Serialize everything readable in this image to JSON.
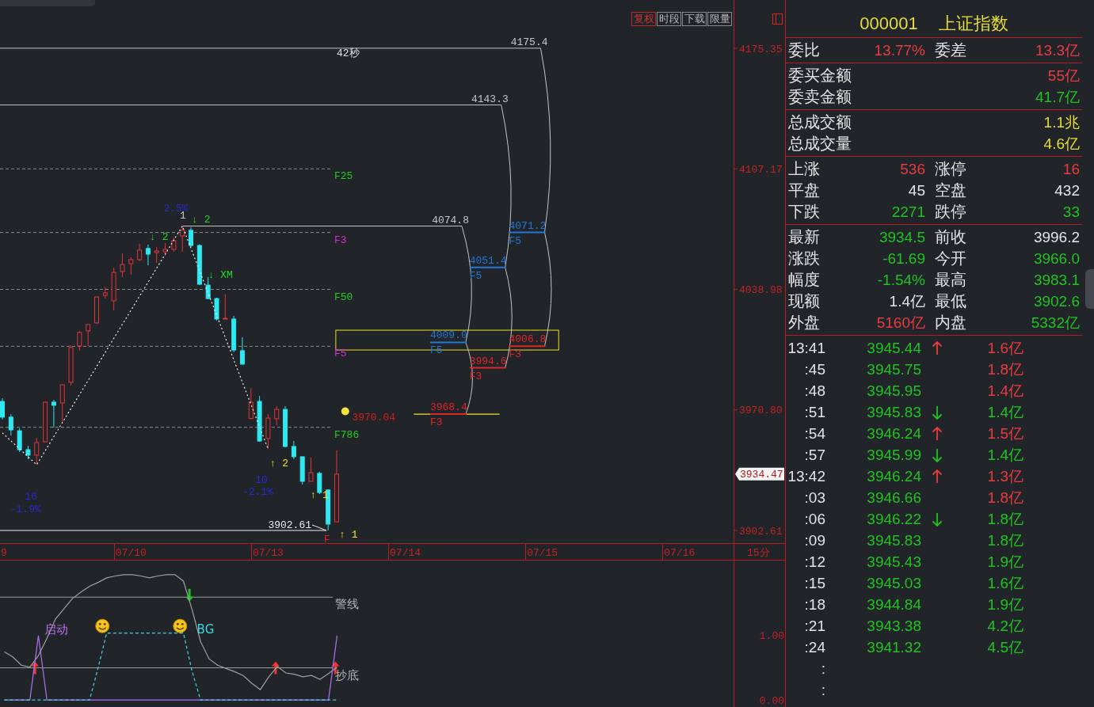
{
  "main_chart": {
    "toolbar": [
      {
        "label": "复权",
        "selected": true
      },
      {
        "label": "时段",
        "selected": false
      },
      {
        "label": "下载",
        "selected": false
      },
      {
        "label": "限量",
        "selected": false
      }
    ],
    "chart_data": [
      {
        "type": "candlestick",
        "categories": [
          "9",
          null,
          null,
          null,
          null,
          null,
          null,
          null,
          null,
          null,
          null,
          null,
          null,
          null,
          null,
          "07/10",
          null,
          null,
          null,
          null,
          null,
          null,
          null,
          null,
          null,
          null,
          null,
          null,
          null,
          null,
          null,
          "07/13",
          null,
          null,
          null,
          null,
          null,
          null,
          null,
          null,
          null,
          null,
          null,
          null,
          null,
          null,
          null,
          "07/14",
          null,
          null,
          null,
          null,
          null,
          null,
          null,
          null,
          null,
          null,
          null,
          null,
          null,
          null,
          null,
          "07/15",
          null,
          null,
          null,
          null,
          null,
          null,
          null,
          null,
          null,
          null,
          null,
          null,
          null,
          null,
          null,
          "07/16",
          null,
          null,
          null,
          null,
          null
        ],
        "ohlc": [
          [
            3975.6,
            3977.4,
            3965.3,
            3966.7
          ],
          [
            3966.7,
            3968.4,
            3956.4,
            3959.5
          ],
          [
            3959.0,
            3960.4,
            3947.0,
            3948.3
          ],
          [
            3948.3,
            3950.5,
            3942.9,
            3945.2
          ],
          [
            3945.2,
            3955.0,
            3939.8,
            3952.3
          ],
          [
            3952.8,
            3975.6,
            3952.3,
            3975.2
          ],
          [
            3975.2,
            3976.5,
            3960.8,
            3973.4
          ],
          [
            3974.7,
            3985.5,
            3964.0,
            3985.0
          ],
          [
            3986.4,
            4007.4,
            3984.6,
            4006.1
          ],
          [
            4007.0,
            4015.5,
            4004.3,
            4014.6
          ],
          [
            4015.5,
            4019.1,
            4007.0,
            4019.1
          ],
          [
            4020.0,
            4035.0,
            4019.6,
            4034.7
          ],
          [
            4035.6,
            4040.6,
            4033.8,
            4037.0
          ],
          [
            4032.5,
            4051.3,
            4027.1,
            4048.6
          ],
          [
            4049.1,
            4059.4,
            4045.9,
            4053.1
          ],
          [
            4053.5,
            4057.1,
            4047.3,
            4055.8
          ],
          [
            4055.8,
            4064.7,
            4054.9,
            4061.2
          ],
          [
            4062.1,
            4064.3,
            4052.6,
            4058.9
          ],
          [
            4059.8,
            4062.9,
            4054.0,
            4060.7
          ],
          [
            4060.3,
            4065.2,
            4058.0,
            4061.6
          ],
          [
            4061.6,
            4068.3,
            4060.3,
            4066.5
          ],
          [
            4069.2,
            4074.8,
            4060.3,
            4072.4
          ],
          [
            4072.4,
            4074.1,
            4062.9,
            4063.8
          ],
          [
            4063.8,
            4064.5,
            4041.4,
            4041.9
          ],
          [
            4041.4,
            4045.9,
            4033.4,
            4033.8
          ],
          [
            4033.8,
            4034.3,
            4021.3,
            4022.2
          ],
          [
            4022.2,
            4036.3,
            4022.2,
            4022.6
          ],
          [
            4022.2,
            4024.0,
            4003.4,
            4004.7
          ],
          [
            4004.3,
            4011.9,
            3996.2,
            3996.7
          ],
          [
            3966.0,
            3983.1,
            3965.3,
            3975.2
          ],
          [
            3975.6,
            3978.7,
            3952.8,
            3953.2
          ],
          [
            3954.6,
            3968.4,
            3948.7,
            3966.2
          ],
          [
            3965.8,
            3972.9,
            3962.2,
            3971.1
          ],
          [
            3971.1,
            3972.9,
            3949.6,
            3950.1
          ],
          [
            3950.1,
            3953.2,
            3942.9,
            3944.3
          ],
          [
            3944.3,
            3944.3,
            3928.6,
            3930.4
          ],
          [
            3930.4,
            3943.8,
            3930.4,
            3935.3
          ],
          [
            3934.9,
            3935.8,
            3923.2,
            3924.1
          ],
          [
            3925.5,
            3925.9,
            3902.61,
            3906.2
          ],
          [
            3907.5,
            3947.8,
            3907.1,
            3934.47
          ],
          null,
          null,
          null,
          null,
          null,
          null,
          null,
          null,
          null,
          null,
          null,
          null,
          null,
          null,
          null,
          null,
          null,
          null,
          null,
          null,
          null,
          null,
          null,
          null,
          null,
          null,
          null,
          null,
          null,
          null,
          null,
          null,
          null,
          null,
          null,
          null,
          null,
          null,
          null,
          null,
          null,
          null,
          null,
          null,
          null
        ],
        "ylim": [
          3895.45,
          4202.67
        ],
        "yticks": [
          4175.35,
          4107.17,
          4038.98,
          {
            "value": 3970.8,
            "label": "3970.80"
          },
          3902.61
        ],
        "series": [
          {
            "type": "line",
            "color": "#f0f0f0",
            "line_style": "dotted",
            "values": [
              3957.8,
              3953.3,
              3948.8,
              3944.3,
              3939.8,
              3947.7,
              3955.7,
              3963.6,
              3971.6,
              3979.5,
              3987.4,
              3995.4,
              4003.3,
              4011.3,
              4019.2,
              4027.1,
              4035.1,
              4043.0,
              4051.0,
              4058.9,
              4066.9,
              4074.8,
              4062.2,
              4049.6,
              4037.0,
              4024.4,
              4011.8,
              3999.1,
              3986.5,
              3973.9,
              3961.3,
              3948.7,
              null,
              null,
              null,
              null,
              null,
              null,
              null,
              null,
              null,
              null,
              null,
              null,
              null,
              null,
              null,
              null,
              null,
              null,
              null,
              null,
              null,
              null,
              null,
              null,
              null,
              null,
              null,
              null,
              null,
              null,
              null,
              null,
              null,
              null,
              null,
              null,
              null,
              null,
              null,
              null,
              null,
              null,
              null,
              null,
              null,
              null,
              null,
              null,
              null,
              null,
              null,
              null,
              null
            ]
          },
          {
            "type": "scatter",
            "color": "#f2e63a",
            "values": [
              null,
              null,
              null,
              null,
              null,
              null,
              null,
              null,
              null,
              null,
              null,
              null,
              null,
              null,
              null,
              null,
              null,
              null,
              null,
              null,
              null,
              null,
              null,
              null,
              null,
              null,
              null,
              null,
              null,
              null,
              null,
              null,
              null,
              null,
              null,
              null,
              null,
              null,
              null,
              null,
              3970,
              null,
              null,
              null,
              null,
              null,
              null,
              null,
              null,
              null,
              null,
              null,
              null,
              null,
              null,
              null,
              null,
              null,
              null,
              null,
              null,
              null,
              null,
              null,
              null,
              null,
              null,
              null,
              null,
              null,
              null,
              null,
              null,
              null,
              null,
              null,
              null,
              null,
              null,
              null,
              null,
              null,
              null,
              null,
              null
            ]
          },
          {
            "type": "line",
            "color": "#f0e030",
            "values": [
              null,
              null,
              null,
              null,
              null,
              null,
              null,
              null,
              null,
              null,
              null,
              null,
              null,
              null,
              null,
              null,
              null,
              null,
              null,
              null,
              null,
              null,
              null,
              null,
              null,
              null,
              null,
              null,
              null,
              null,
              null,
              null,
              null,
              null,
              null,
              null,
              null,
              null,
              null,
              null,
              null,
              null,
              null,
              null,
              null,
              null,
              null,
              null,
              3968.4,
              3968.4,
              3968.4,
              3968.4,
              3968.4,
              3968.4,
              3968.4,
              3968.4,
              3968.4,
              3968.4,
              3968.4,
              null,
              null,
              null,
              null,
              null,
              null,
              null,
              null,
              null,
              null,
              null,
              null,
              null,
              null,
              null,
              null,
              null,
              null,
              null,
              null,
              null,
              null,
              null,
              null,
              null,
              null
            ]
          }
        ],
        "ref_lines": [
          {
            "axis": "y",
            "value": 4107.17,
            "label": "F25",
            "line_style": "dashed"
          },
          {
            "axis": "y",
            "value": 4071.16,
            "label": "F3",
            "line_style": "dashed"
          },
          {
            "axis": "y",
            "value": 4038.98,
            "label": "F50",
            "line_style": "dashed"
          },
          {
            "axis": "y",
            "value": 4006.8,
            "label": "F5",
            "line_style": "dashed"
          },
          {
            "axis": "y",
            "value": 3960.98,
            "label": "F786",
            "line_style": "dashed"
          },
          {
            "axis": "y",
            "value": 4175.4,
            "label": "4175.4",
            "line_style": "solid"
          },
          {
            "axis": "y",
            "value": 4143.3,
            "label": "4143.3",
            "line_style": "solid"
          },
          {
            "axis": "y",
            "value": 4074.8,
            "label": "4074.8",
            "line_style": "solid"
          },
          {
            "axis": "y",
            "value": 4071.2,
            "label": "4071.2",
            "color": "#2378d6"
          },
          {
            "axis": "y",
            "value": 4006.8,
            "label": "4006.8",
            "color": "#e02626"
          },
          {
            "axis": "y",
            "value": 4051.4,
            "label": "4051.4",
            "color": "#2378d6"
          },
          {
            "axis": "y",
            "value": 3994.6,
            "label": "3994.6",
            "color": "#e02626"
          },
          {
            "axis": "y",
            "value": 4009.0,
            "label": "4009.0",
            "color": "#2378d6"
          },
          {
            "axis": "y",
            "value": 3968.4,
            "label": "3968.4",
            "color": "#e02626"
          },
          {
            "axis": "y",
            "value": 3902.61,
            "label": "3902.61",
            "line_style": "solid"
          }
        ],
        "annotations": [
          "42秒",
          "2.5%",
          "1",
          "↓ 2",
          "↓ 2",
          "↓ XM",
          "16",
          "-1.9%",
          "10",
          "-2.1%",
          "↑ 2",
          "↑ 1",
          "F",
          "↑ 1",
          "3970.04",
          "F5",
          "F3",
          "F5",
          "F3",
          "F5",
          "F3"
        ]
      },
      {
        "type": "line",
        "categories": [
          null,
          null,
          null,
          null,
          null,
          null,
          null,
          null,
          null,
          null,
          null,
          null,
          null,
          null,
          null,
          null,
          null,
          null,
          null,
          null,
          null,
          null,
          null,
          null,
          null,
          null,
          null,
          null,
          null,
          null,
          null,
          null,
          null,
          null,
          null,
          null,
          null,
          null,
          null,
          null,
          null,
          null,
          null,
          null,
          null,
          null,
          null,
          null,
          null,
          null,
          null,
          null,
          null,
          null,
          null,
          null,
          null,
          null,
          null,
          null,
          null,
          null,
          null,
          null,
          null,
          null,
          null,
          null,
          null,
          null,
          null,
          null,
          null,
          null,
          null,
          null,
          null,
          null,
          null,
          null,
          null,
          null,
          null,
          null,
          null,
          null,
          null,
          null,
          null,
          null,
          null,
          null
        ],
        "ylim": [
          -0.11,
          2.17
        ],
        "yticks": [
          {
            "value": 0,
            "label": "0.00"
          },
          {
            "value": 1,
            "label": "1.00"
          }
        ],
        "series": [
          {
            "color": "#a0a0a0",
            "values": [
              0.75,
              0.67,
              0.54,
              0.51,
              0.69,
              0.96,
              1.26,
              1.42,
              1.58,
              1.68,
              1.77,
              1.83,
              1.9,
              1.93,
              1.95,
              1.95,
              1.93,
              1.9,
              1.93,
              1.95,
              1.95,
              1.85,
              1.41,
              0.91,
              0.64,
              0.54,
              0.49,
              0.44,
              0.38,
              0.26,
              0.16,
              0.36,
              0.52,
              0.42,
              0.4,
              0.36,
              0.38,
              0.32,
              0.41,
              0.51,
              null,
              null,
              null,
              null,
              null,
              null,
              null,
              null,
              null,
              null,
              null,
              null,
              null,
              null,
              null,
              null,
              null,
              null,
              null,
              null,
              null,
              null,
              null,
              null,
              null,
              null,
              null,
              null,
              null,
              null,
              null,
              null,
              null,
              null,
              null,
              null,
              null,
              null,
              null,
              null,
              null,
              null,
              null,
              null,
              null,
              null,
              null,
              null,
              null,
              null,
              null,
              null
            ]
          },
          {
            "color": "#b070f0",
            "values": [
              0,
              0,
              0,
              0,
              1,
              0,
              0,
              0,
              0,
              0,
              0,
              0,
              0,
              0,
              0,
              0,
              0,
              0,
              0,
              0,
              0,
              0,
              0,
              0,
              0,
              0,
              0,
              0,
              0,
              0,
              0,
              0,
              0,
              0,
              0,
              0,
              0,
              0,
              0,
              1,
              null,
              null,
              null,
              null,
              null,
              null,
              null,
              null,
              null,
              null,
              null,
              null,
              null,
              null,
              null,
              null,
              null,
              null,
              null,
              null,
              null,
              null,
              null,
              null,
              null,
              null,
              null,
              null,
              null,
              null,
              null,
              null,
              null,
              null,
              null,
              null,
              null,
              null,
              null,
              null,
              null,
              null,
              null,
              null,
              null,
              null,
              null,
              null,
              null,
              null,
              null,
              null
            ]
          },
          {
            "color": "#40d8e0",
            "line_style": "dashed",
            "values": [
              0,
              0,
              0,
              0,
              0,
              0,
              0,
              0,
              0,
              0,
              0,
              0.5,
              1.04,
              1.04,
              1.04,
              1.04,
              1.04,
              1.04,
              1.04,
              1.04,
              1.04,
              1.04,
              0.45,
              0,
              0,
              0,
              0,
              0,
              0,
              0,
              0,
              0,
              0,
              0,
              0,
              0,
              0,
              0,
              0,
              0,
              null,
              null,
              null,
              null,
              null,
              null,
              null,
              null,
              null,
              null,
              null,
              null,
              null,
              null,
              null,
              null,
              null,
              null,
              null,
              null,
              null,
              null,
              null,
              null,
              null,
              null,
              null,
              null,
              null,
              null,
              null,
              null,
              null,
              null,
              null,
              null,
              null,
              null,
              null,
              null,
              null,
              null,
              null,
              null,
              null,
              null,
              null,
              null,
              null,
              null,
              null,
              null
            ]
          }
        ],
        "ref_lines": [
          {
            "axis": "y",
            "value": 1.6,
            "label": "警线"
          },
          {
            "axis": "y",
            "value": 0.5,
            "label": "抄底"
          }
        ],
        "annotations": [
          "启动",
          "BG"
        ]
      }
    ],
    "last_price": "3934.47",
    "period": "15分"
  },
  "quote_panel": {
    "code": "000001",
    "name": "上证指数",
    "sections": [
      {
        "rows": [
          {
            "items": [
              {
                "label": "委比",
                "value": "13.77%",
                "color": "#ea3c40"
              },
              {
                "label": "委差",
                "value": "13.3亿",
                "color": "#ea3c40"
              }
            ]
          }
        ]
      },
      {
        "rows": [
          {
            "items": [
              {
                "label": "委买金额",
                "value": "55亿",
                "color": "#ea3c40"
              }
            ]
          },
          {
            "items": [
              {
                "label": "委卖金额",
                "value": "41.7亿",
                "color": "#22c222"
              }
            ]
          }
        ]
      },
      {
        "rows": [
          {
            "items": [
              {
                "label": "总成交额",
                "value": "1.1兆",
                "color": "#e4dc38"
              }
            ]
          },
          {
            "items": [
              {
                "label": "总成交量",
                "value": "4.6亿",
                "color": "#e4dc38"
              }
            ]
          }
        ]
      },
      {
        "rows": [
          {
            "items": [
              {
                "label": "上涨",
                "value": "536",
                "color": "#ea3c40"
              },
              {
                "label": "涨停",
                "value": "16",
                "color": "#ea3c40"
              }
            ]
          },
          {
            "items": [
              {
                "label": "平盘",
                "value": "45",
                "color": "#e4e4e4"
              },
              {
                "label": "空盘",
                "value": "432",
                "color": "#e4e4e4"
              }
            ]
          },
          {
            "items": [
              {
                "label": "下跌",
                "value": "2271",
                "color": "#22c222"
              },
              {
                "label": "跌停",
                "value": "33",
                "color": "#22c222"
              }
            ]
          }
        ]
      },
      {
        "rows": [
          {
            "items": [
              {
                "label": "最新",
                "value": "3934.5",
                "color": "#22c222"
              },
              {
                "label": "前收",
                "value": "3996.2",
                "color": "#e4e4e4"
              }
            ]
          },
          {
            "items": [
              {
                "label": "涨跌",
                "value": "-61.69",
                "color": "#22c222"
              },
              {
                "label": "今开",
                "value": "3966.0",
                "color": "#22c222"
              }
            ]
          },
          {
            "items": [
              {
                "label": "幅度",
                "value": "-1.54%",
                "color": "#22c222"
              },
              {
                "label": "最高",
                "value": "3983.1",
                "color": "#22c222"
              }
            ]
          },
          {
            "items": [
              {
                "label": "现额",
                "value": "1.4亿",
                "color": "#e4e4e4"
              },
              {
                "label": "最低",
                "value": "3902.6",
                "color": "#22c222"
              }
            ]
          },
          {
            "items": [
              {
                "label": "外盘",
                "value": "5160亿",
                "color": "#ea3c40"
              },
              {
                "label": "内盘",
                "value": "5332亿",
                "color": "#22c222"
              }
            ]
          }
        ]
      }
    ],
    "ticks": [
      {
        "time": "13:41",
        "price": "3945.44",
        "kind": "up",
        "amount": "1.6亿",
        "color": "#ea3c40"
      },
      {
        "time": ":45",
        "price": "3945.75",
        "kind": "flat",
        "amount": "1.8亿",
        "color": "#ea3c40"
      },
      {
        "time": ":48",
        "price": "3945.95",
        "kind": "flat",
        "amount": "1.4亿",
        "color": "#ea3c40"
      },
      {
        "time": ":51",
        "price": "3945.83",
        "kind": "down",
        "amount": "1.4亿",
        "color": "#22c222"
      },
      {
        "time": ":54",
        "price": "3946.24",
        "kind": "up",
        "amount": "1.5亿",
        "color": "#ea3c40"
      },
      {
        "time": ":57",
        "price": "3945.99",
        "kind": "down",
        "amount": "1.4亿",
        "color": "#22c222"
      },
      {
        "time": "13:42",
        "price": "3946.24",
        "kind": "up",
        "amount": "1.3亿",
        "color": "#ea3c40"
      },
      {
        "time": ":03",
        "price": "3946.66",
        "kind": "flat",
        "amount": "1.8亿",
        "color": "#ea3c40"
      },
      {
        "time": ":06",
        "price": "3946.22",
        "kind": "down",
        "amount": "1.8亿",
        "color": "#22c222"
      },
      {
        "time": ":09",
        "price": "3945.83",
        "kind": "flat",
        "amount": "1.8亿",
        "color": "#22c222"
      },
      {
        "time": ":12",
        "price": "3945.43",
        "kind": "flat",
        "amount": "1.9亿",
        "color": "#22c222"
      },
      {
        "time": ":15",
        "price": "3945.03",
        "kind": "flat",
        "amount": "1.6亿",
        "color": "#22c222"
      },
      {
        "time": ":18",
        "price": "3944.84",
        "kind": "flat",
        "amount": "1.9亿",
        "color": "#22c222"
      },
      {
        "time": ":21",
        "price": "3943.38",
        "kind": "flat",
        "amount": "4.2亿",
        "color": "#22c222"
      },
      {
        "time": ":24",
        "price": "3941.32",
        "kind": "flat",
        "amount": "4.5亿",
        "color": "#22c222"
      },
      {
        "time": ":",
        "kind": "flat"
      },
      {
        "time": ":",
        "kind": "flat"
      }
    ]
  }
}
